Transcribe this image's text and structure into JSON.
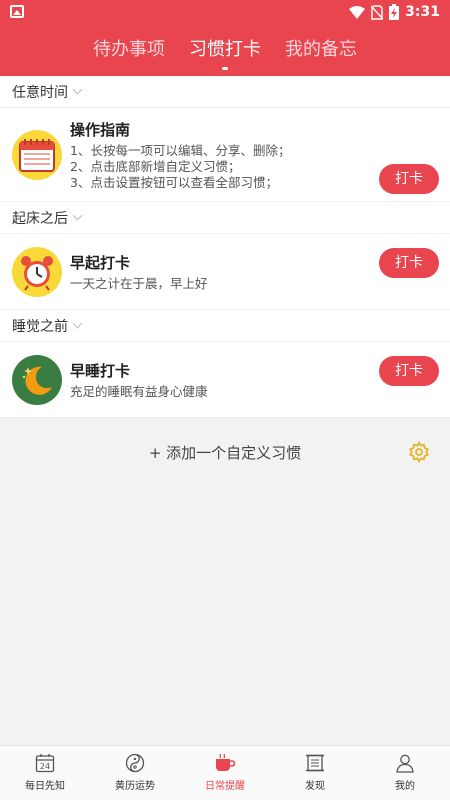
{
  "status_bar": {
    "time": "3:31"
  },
  "tabs": [
    {
      "label": "待办事项",
      "active": false
    },
    {
      "label": "习惯打卡",
      "active": true
    },
    {
      "label": "我的备忘",
      "active": false
    }
  ],
  "groups": [
    {
      "header": "任意时间",
      "item": {
        "title": "操作指南",
        "desc": [
          "1、长按每一项可以编辑、分享、删除；",
          "2、点击底部新增自定义习惯；",
          "3、点击设置按钮可以查看全部习惯；"
        ],
        "button": "打卡",
        "icon": "calendar-icon"
      }
    },
    {
      "header": "起床之后",
      "item": {
        "title": "早起打卡",
        "desc": [
          "一天之计在于晨，早上好"
        ],
        "button": "打卡",
        "icon": "alarm-clock-icon"
      }
    },
    {
      "header": "睡觉之前",
      "item": {
        "title": "早睡打卡",
        "desc": [
          "充足的睡眠有益身心健康"
        ],
        "button": "打卡",
        "icon": "moon-icon"
      }
    }
  ],
  "add_habit": "+ 添加一个自定义习惯",
  "bottom_nav": [
    {
      "label": "每日先知",
      "icon": "calendar-24-icon",
      "badge": "24",
      "active": false
    },
    {
      "label": "黄历运势",
      "icon": "yin-yang-icon",
      "active": false
    },
    {
      "label": "日常提醒",
      "icon": "cup-icon",
      "active": true
    },
    {
      "label": "发现",
      "icon": "scroll-icon",
      "active": false
    },
    {
      "label": "我的",
      "icon": "user-icon",
      "active": false
    }
  ],
  "colors": {
    "accent": "#e8454f",
    "gear": "#e6b422"
  }
}
